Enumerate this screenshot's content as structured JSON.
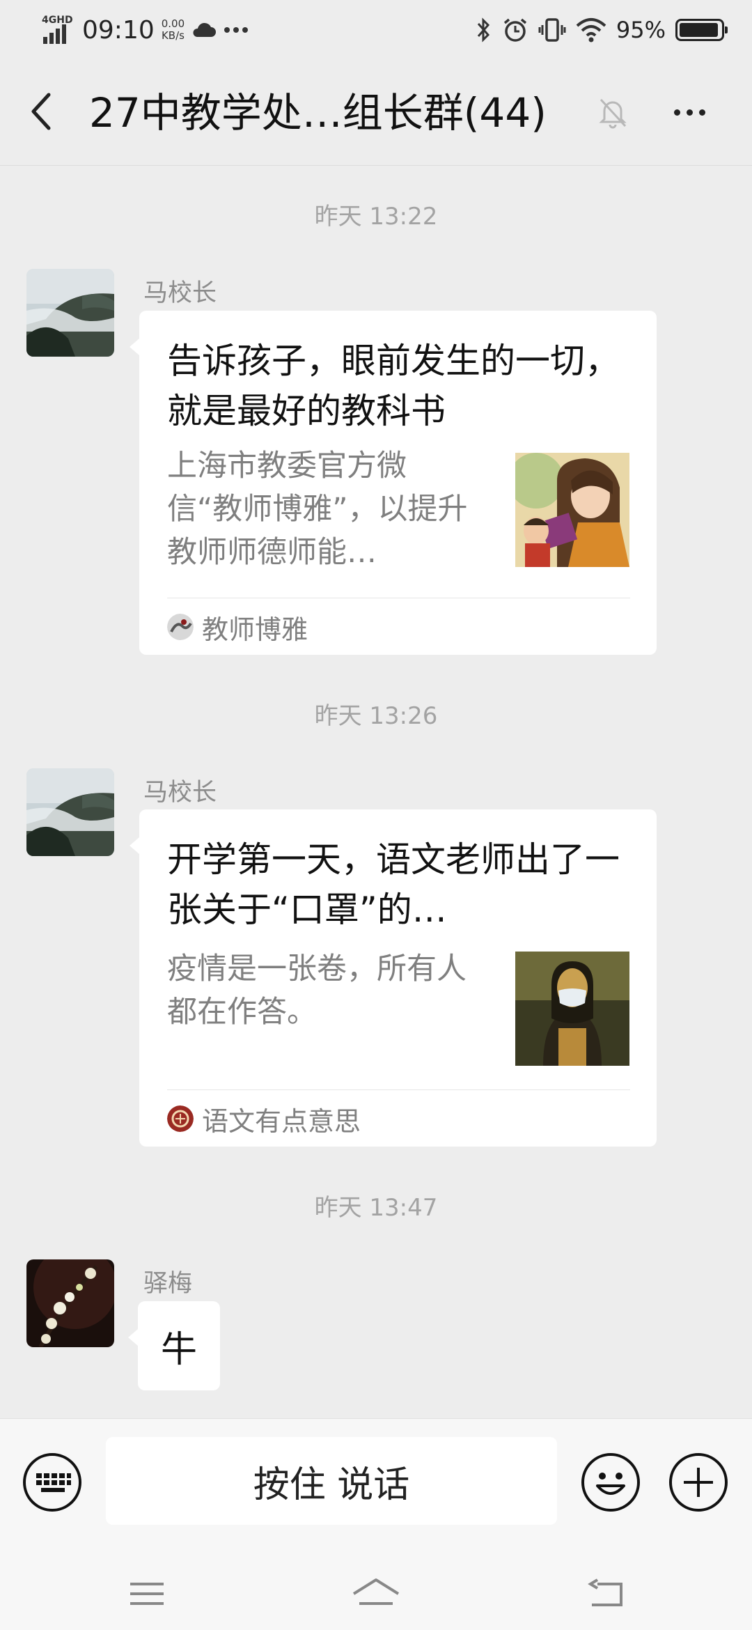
{
  "status_bar": {
    "network": "4GHD",
    "time": "09:10",
    "speed_value": "0.00",
    "speed_unit": "KB/s",
    "battery_percent": "95%",
    "battery_level": 0.95
  },
  "header": {
    "title": "27中教学处…组长群(44)"
  },
  "messages": [
    {
      "timestamp": "昨天 13:22",
      "sender": "马校长",
      "card": {
        "title": "告诉孩子，眼前发生的一切，就是最好的教科书",
        "description": "上海市教委官方微信“教师博雅”，以提升教师师德师能…",
        "source": "教师博雅"
      }
    },
    {
      "timestamp": "昨天 13:26",
      "sender": "马校长",
      "card": {
        "title": "开学第一天，语文老师出了一张关于“口罩”的…",
        "description": "疫情是一张卷，所有人都在作答。",
        "source": "语文有点意思"
      }
    },
    {
      "timestamp": "昨天 13:47",
      "sender": "驿梅",
      "text": "牛"
    }
  ],
  "input_bar": {
    "hold_to_talk_label": "按住 说话"
  },
  "icons": {
    "back": "back-arrow-icon",
    "mute": "mute-bell-icon",
    "more": "more-icon",
    "keyboard": "keyboard-icon",
    "emoji": "emoji-icon",
    "plus": "plus-icon",
    "menu": "menu-icon",
    "home": "home-icon",
    "return": "back-nav-icon"
  }
}
